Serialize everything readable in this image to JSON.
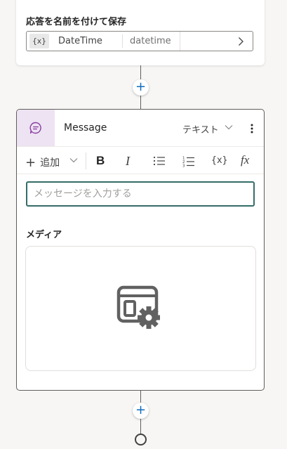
{
  "save_section": {
    "title": "応答を名前を付けて保存",
    "variable_icon": "{x}",
    "variable_name": "DateTime",
    "variable_type": "datetime"
  },
  "message_node": {
    "title": "Message",
    "type_label": "テキスト",
    "toolbar": {
      "add_label": "追加",
      "bold_label": "B",
      "italic_label": "I",
      "variable_label": "{x}",
      "formula_label": "fx"
    },
    "input_placeholder": "メッセージを入力する",
    "media_title": "メディア"
  },
  "icons": {
    "message": "chat-bubble-icon",
    "media": "image-settings-icon",
    "add": "plus-icon",
    "more": "more-vertical-icon"
  },
  "colors": {
    "accent": "#0f6cbd",
    "message_header_bg": "#ede3f2",
    "message_icon": "#8a3ea3",
    "input_border": "#356d68"
  }
}
